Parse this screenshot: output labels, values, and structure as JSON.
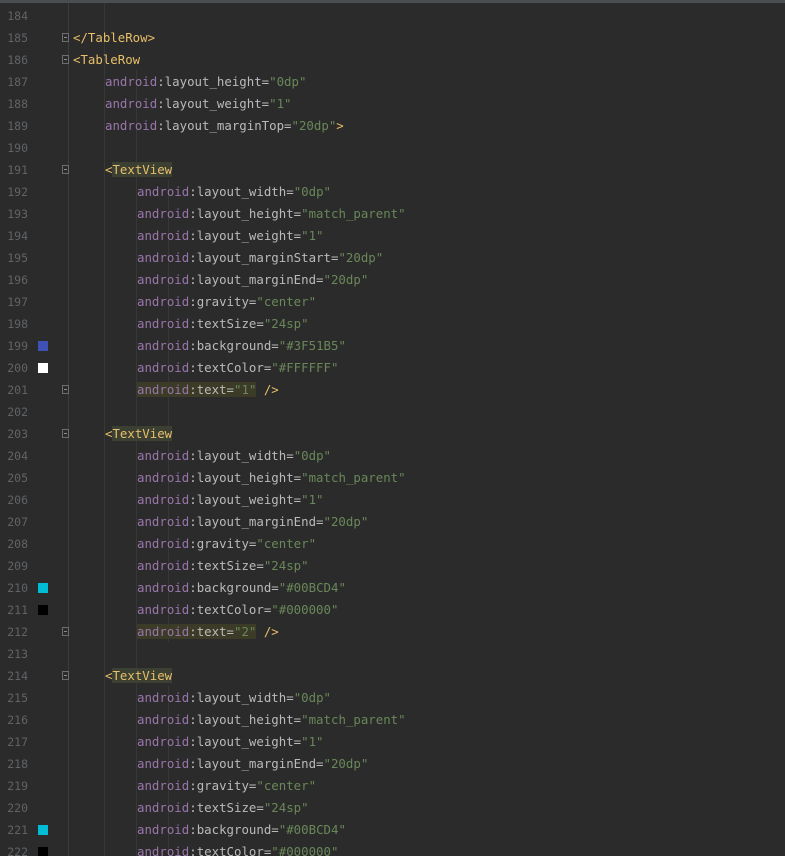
{
  "editor": {
    "lines": [
      {
        "number": "184"
      },
      {
        "number": "185",
        "fold": true,
        "indent": 2,
        "kind": "close",
        "open": "</",
        "tag": "TableRow",
        "close": ">"
      },
      {
        "number": "186",
        "fold": true,
        "indent": 2,
        "kind": "open",
        "open": "<",
        "tag": "TableRow"
      },
      {
        "number": "187",
        "indent": 3,
        "kind": "attr",
        "ns": "android",
        "sep": ":",
        "attr": "layout_height",
        "eq": "=",
        "value": "\"0dp\""
      },
      {
        "number": "188",
        "indent": 3,
        "kind": "attr",
        "ns": "android",
        "sep": ":",
        "attr": "layout_weight",
        "eq": "=",
        "value": "\"1\""
      },
      {
        "number": "189",
        "indent": 3,
        "kind": "attr",
        "ns": "android",
        "sep": ":",
        "attr": "layout_marginTop",
        "eq": "=",
        "value": "\"20dp\"",
        "suffix": ">"
      },
      {
        "number": "190"
      },
      {
        "number": "191",
        "fold": true,
        "indent": 3,
        "kind": "open",
        "open": "<",
        "tag": "TextView",
        "tag_highlight": true
      },
      {
        "number": "192",
        "indent": 4,
        "kind": "attr",
        "ns": "android",
        "sep": ":",
        "attr": "layout_width",
        "eq": "=",
        "value": "\"0dp\""
      },
      {
        "number": "193",
        "indent": 4,
        "kind": "attr",
        "ns": "android",
        "sep": ":",
        "attr": "layout_height",
        "eq": "=",
        "value": "\"match_parent\""
      },
      {
        "number": "194",
        "indent": 4,
        "kind": "attr",
        "ns": "android",
        "sep": ":",
        "attr": "layout_weight",
        "eq": "=",
        "value": "\"1\""
      },
      {
        "number": "195",
        "indent": 4,
        "kind": "attr",
        "ns": "android",
        "sep": ":",
        "attr": "layout_marginStart",
        "eq": "=",
        "value": "\"20dp\""
      },
      {
        "number": "196",
        "indent": 4,
        "kind": "attr",
        "ns": "android",
        "sep": ":",
        "attr": "layout_marginEnd",
        "eq": "=",
        "value": "\"20dp\""
      },
      {
        "number": "197",
        "indent": 4,
        "kind": "attr",
        "ns": "android",
        "sep": ":",
        "attr": "gravity",
        "eq": "=",
        "value": "\"center\""
      },
      {
        "number": "198",
        "indent": 4,
        "kind": "attr",
        "ns": "android",
        "sep": ":",
        "attr": "textSize",
        "eq": "=",
        "value": "\"24sp\""
      },
      {
        "number": "199",
        "swatch": "#3F51B5",
        "indent": 4,
        "kind": "attr",
        "ns": "android",
        "sep": ":",
        "attr": "background",
        "eq": "=",
        "value": "\"#3F51B5\""
      },
      {
        "number": "200",
        "swatch": "#FFFFFF",
        "indent": 4,
        "kind": "attr",
        "ns": "android",
        "sep": ":",
        "attr": "textColor",
        "eq": "=",
        "value": "\"#FFFFFF\""
      },
      {
        "number": "201",
        "fold": true,
        "indent": 4,
        "kind": "attr",
        "highlight": true,
        "ns": "android",
        "sep": ":",
        "attr": "text",
        "eq": "=",
        "value": "\"1\"",
        "suffix": " />"
      },
      {
        "number": "202"
      },
      {
        "number": "203",
        "fold": true,
        "indent": 3,
        "kind": "open",
        "open": "<",
        "tag": "TextView",
        "tag_highlight": true
      },
      {
        "number": "204",
        "indent": 4,
        "kind": "attr",
        "ns": "android",
        "sep": ":",
        "attr": "layout_width",
        "eq": "=",
        "value": "\"0dp\""
      },
      {
        "number": "205",
        "indent": 4,
        "kind": "attr",
        "ns": "android",
        "sep": ":",
        "attr": "layout_height",
        "eq": "=",
        "value": "\"match_parent\""
      },
      {
        "number": "206",
        "indent": 4,
        "kind": "attr",
        "ns": "android",
        "sep": ":",
        "attr": "layout_weight",
        "eq": "=",
        "value": "\"1\""
      },
      {
        "number": "207",
        "indent": 4,
        "kind": "attr",
        "ns": "android",
        "sep": ":",
        "attr": "layout_marginEnd",
        "eq": "=",
        "value": "\"20dp\""
      },
      {
        "number": "208",
        "indent": 4,
        "kind": "attr",
        "ns": "android",
        "sep": ":",
        "attr": "gravity",
        "eq": "=",
        "value": "\"center\""
      },
      {
        "number": "209",
        "indent": 4,
        "kind": "attr",
        "ns": "android",
        "sep": ":",
        "attr": "textSize",
        "eq": "=",
        "value": "\"24sp\""
      },
      {
        "number": "210",
        "swatch": "#00BCD4",
        "indent": 4,
        "kind": "attr",
        "ns": "android",
        "sep": ":",
        "attr": "background",
        "eq": "=",
        "value": "\"#00BCD4\""
      },
      {
        "number": "211",
        "swatch": "#000000",
        "indent": 4,
        "kind": "attr",
        "ns": "android",
        "sep": ":",
        "attr": "textColor",
        "eq": "=",
        "value": "\"#000000\""
      },
      {
        "number": "212",
        "fold": true,
        "indent": 4,
        "kind": "attr",
        "highlight": true,
        "ns": "android",
        "sep": ":",
        "attr": "text",
        "eq": "=",
        "value": "\"2\"",
        "suffix": " />"
      },
      {
        "number": "213"
      },
      {
        "number": "214",
        "fold": true,
        "indent": 3,
        "kind": "open",
        "open": "<",
        "tag": "TextView",
        "tag_highlight": true
      },
      {
        "number": "215",
        "indent": 4,
        "kind": "attr",
        "ns": "android",
        "sep": ":",
        "attr": "layout_width",
        "eq": "=",
        "value": "\"0dp\""
      },
      {
        "number": "216",
        "indent": 4,
        "kind": "attr",
        "ns": "android",
        "sep": ":",
        "attr": "layout_height",
        "eq": "=",
        "value": "\"match_parent\""
      },
      {
        "number": "217",
        "indent": 4,
        "kind": "attr",
        "ns": "android",
        "sep": ":",
        "attr": "layout_weight",
        "eq": "=",
        "value": "\"1\""
      },
      {
        "number": "218",
        "indent": 4,
        "kind": "attr",
        "ns": "android",
        "sep": ":",
        "attr": "layout_marginEnd",
        "eq": "=",
        "value": "\"20dp\""
      },
      {
        "number": "219",
        "indent": 4,
        "kind": "attr",
        "ns": "android",
        "sep": ":",
        "attr": "gravity",
        "eq": "=",
        "value": "\"center\""
      },
      {
        "number": "220",
        "indent": 4,
        "kind": "attr",
        "ns": "android",
        "sep": ":",
        "attr": "textSize",
        "eq": "=",
        "value": "\"24sp\""
      },
      {
        "number": "221",
        "swatch": "#00BCD4",
        "indent": 4,
        "kind": "attr",
        "ns": "android",
        "sep": ":",
        "attr": "background",
        "eq": "=",
        "value": "\"#00BCD4\""
      },
      {
        "number": "222",
        "swatch": "#000000",
        "indent": 4,
        "kind": "attr",
        "ns": "android",
        "sep": ":",
        "attr": "textColor",
        "eq": "=",
        "value": "\"#000000\""
      }
    ]
  }
}
